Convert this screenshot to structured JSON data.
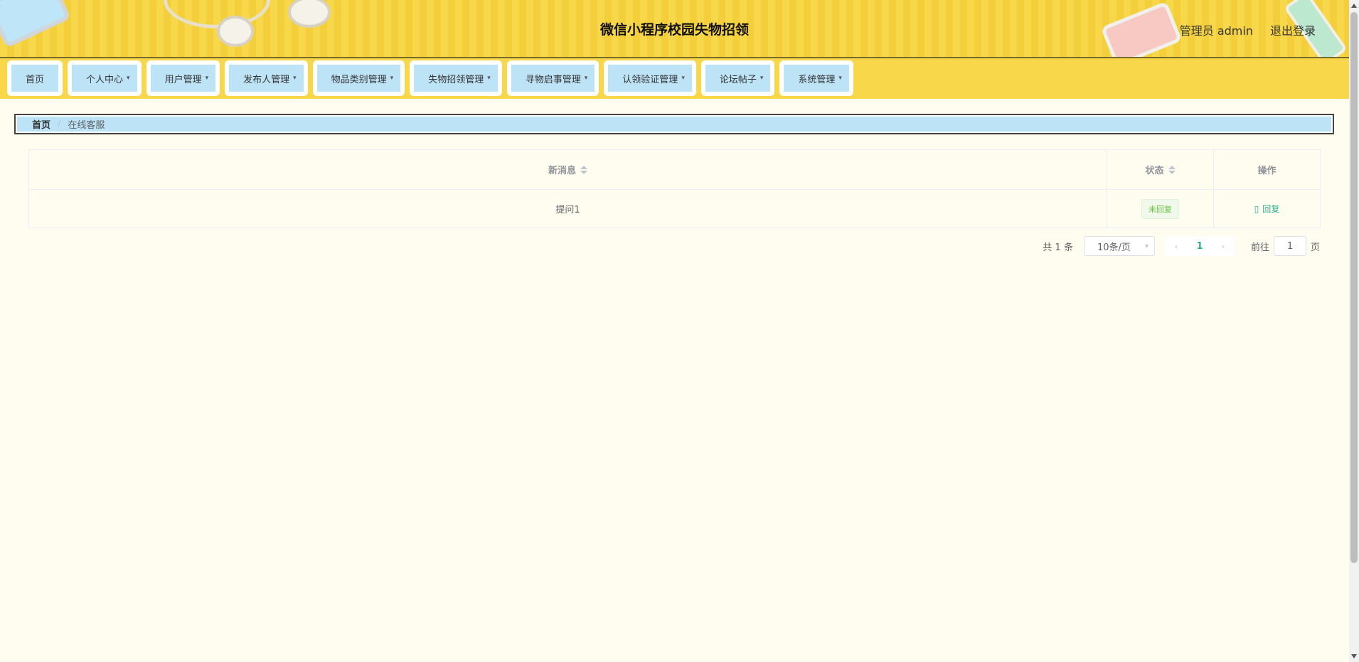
{
  "header": {
    "title": "微信小程序校园失物招领",
    "user_label": "管理员 admin",
    "logout_label": "退出登录"
  },
  "nav": {
    "items": [
      {
        "label": "首页"
      },
      {
        "label": "个人中心"
      },
      {
        "label": "用户管理"
      },
      {
        "label": "发布人管理"
      },
      {
        "label": "物品类别管理"
      },
      {
        "label": "失物招领管理"
      },
      {
        "label": "寻物启事管理"
      },
      {
        "label": "认领验证管理"
      },
      {
        "label": "论坛帖子"
      },
      {
        "label": "系统管理"
      }
    ],
    "caret_icon": "chevron-down-icon"
  },
  "breadcrumb": {
    "home": "首页",
    "separator": "/",
    "current": "在线客服"
  },
  "table": {
    "columns": [
      "新消息",
      "状态",
      "操作"
    ],
    "rows": [
      {
        "message": "提问1",
        "status": "未回复",
        "action": "回复"
      }
    ]
  },
  "pagination": {
    "total_text": "共 1 条",
    "page_size": "10条/页",
    "current_page": "1",
    "goto_label": "前往",
    "goto_value": "1",
    "page_suffix": "页"
  },
  "colors": {
    "header_bg": "#f8d84a",
    "nav_item_bg": "#bde3f7",
    "page_bg": "#fefdf0",
    "accent": "#2bae8e",
    "tag_green": "#67c23a"
  }
}
